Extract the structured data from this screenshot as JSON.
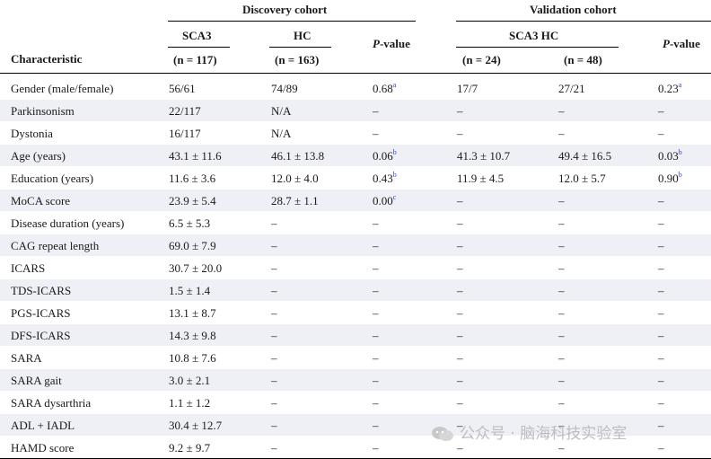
{
  "header": {
    "discovery": "Discovery cohort",
    "validation": "Validation cohort",
    "characteristic": "Characteristic",
    "sca3": "SCA3",
    "hc": "HC",
    "pvalue_p": "P",
    "pvalue_rest": "-value",
    "sca3_n": "(n = 117)",
    "hc_n": "(n = 163)",
    "val_group": "SCA3 HC",
    "val_sca3_n": "(n = 24)",
    "val_hc_n": "(n = 48)"
  },
  "rows": [
    {
      "label": "Gender (male/female)",
      "d_sca3": "56/61",
      "d_hc": "74/89",
      "d_p": "0.68",
      "d_p_sup": "a",
      "v_sca3": "17/7",
      "v_hc": "27/21",
      "v_p": "0.23",
      "v_p_sup": "a"
    },
    {
      "label": "Parkinsonism",
      "d_sca3": "22/117",
      "d_hc": "N/A",
      "d_p": "–",
      "d_p_sup": "",
      "v_sca3": "–",
      "v_hc": "–",
      "v_p": "–",
      "v_p_sup": ""
    },
    {
      "label": "Dystonia",
      "d_sca3": "16/117",
      "d_hc": "N/A",
      "d_p": "–",
      "d_p_sup": "",
      "v_sca3": "–",
      "v_hc": "–",
      "v_p": "–",
      "v_p_sup": ""
    },
    {
      "label": "Age (years)",
      "d_sca3": "43.1 ± 11.6",
      "d_hc": "46.1 ± 13.8",
      "d_p": "0.06",
      "d_p_sup": "b",
      "v_sca3": "41.3 ± 10.7",
      "v_hc": "49.4 ± 16.5",
      "v_p": "0.03",
      "v_p_sup": "b"
    },
    {
      "label": "Education (years)",
      "d_sca3": "11.6 ± 3.6",
      "d_hc": "12.0 ± 4.0",
      "d_p": "0.43",
      "d_p_sup": "b",
      "v_sca3": "11.9 ± 4.5",
      "v_hc": "12.0 ± 5.7",
      "v_p": "0.90",
      "v_p_sup": "b"
    },
    {
      "label": "MoCA score",
      "d_sca3": "23.9 ± 5.4",
      "d_hc": "28.7 ± 1.1",
      "d_p": "0.00",
      "d_p_sup": "c",
      "v_sca3": "–",
      "v_hc": "–",
      "v_p": "–",
      "v_p_sup": ""
    },
    {
      "label": "Disease duration (years)",
      "d_sca3": "6.5 ± 5.3",
      "d_hc": "–",
      "d_p": "–",
      "d_p_sup": "",
      "v_sca3": "–",
      "v_hc": "–",
      "v_p": "–",
      "v_p_sup": ""
    },
    {
      "label": "CAG repeat length",
      "d_sca3": "69.0 ± 7.9",
      "d_hc": "–",
      "d_p": "–",
      "d_p_sup": "",
      "v_sca3": "–",
      "v_hc": "–",
      "v_p": "–",
      "v_p_sup": ""
    },
    {
      "label": "ICARS",
      "d_sca3": "30.7 ± 20.0",
      "d_hc": "–",
      "d_p": "–",
      "d_p_sup": "",
      "v_sca3": "–",
      "v_hc": "–",
      "v_p": "–",
      "v_p_sup": ""
    },
    {
      "label": "TDS-ICARS",
      "d_sca3": "1.5 ± 1.4",
      "d_hc": "–",
      "d_p": "–",
      "d_p_sup": "",
      "v_sca3": "–",
      "v_hc": "–",
      "v_p": "–",
      "v_p_sup": ""
    },
    {
      "label": "PGS-ICARS",
      "d_sca3": "13.1 ± 8.7",
      "d_hc": "–",
      "d_p": "–",
      "d_p_sup": "",
      "v_sca3": "–",
      "v_hc": "–",
      "v_p": "–",
      "v_p_sup": ""
    },
    {
      "label": "DFS-ICARS",
      "d_sca3": "14.3 ± 9.8",
      "d_hc": "–",
      "d_p": "–",
      "d_p_sup": "",
      "v_sca3": "–",
      "v_hc": "–",
      "v_p": "–",
      "v_p_sup": ""
    },
    {
      "label": "SARA",
      "d_sca3": "10.8 ± 7.6",
      "d_hc": "–",
      "d_p": "–",
      "d_p_sup": "",
      "v_sca3": "–",
      "v_hc": "–",
      "v_p": "–",
      "v_p_sup": ""
    },
    {
      "label": "SARA gait",
      "d_sca3": "3.0 ± 2.1",
      "d_hc": "–",
      "d_p": "–",
      "d_p_sup": "",
      "v_sca3": "–",
      "v_hc": "–",
      "v_p": "–",
      "v_p_sup": ""
    },
    {
      "label": "SARA dysarthria",
      "d_sca3": "1.1 ± 1.2",
      "d_hc": "–",
      "d_p": "–",
      "d_p_sup": "",
      "v_sca3": "–",
      "v_hc": "–",
      "v_p": "–",
      "v_p_sup": ""
    },
    {
      "label": "ADL + IADL",
      "d_sca3": "30.4 ± 12.7",
      "d_hc": "–",
      "d_p": "–",
      "d_p_sup": "",
      "v_sca3": "–",
      "v_hc": "–",
      "v_p": "–",
      "v_p_sup": ""
    },
    {
      "label": "HAMD score",
      "d_sca3": "9.2 ± 9.7",
      "d_hc": "–",
      "d_p": "–",
      "d_p_sup": "",
      "v_sca3": "–",
      "v_hc": "–",
      "v_p": "–",
      "v_p_sup": ""
    }
  ],
  "watermark": "公众号 · 脑海科技实验室"
}
